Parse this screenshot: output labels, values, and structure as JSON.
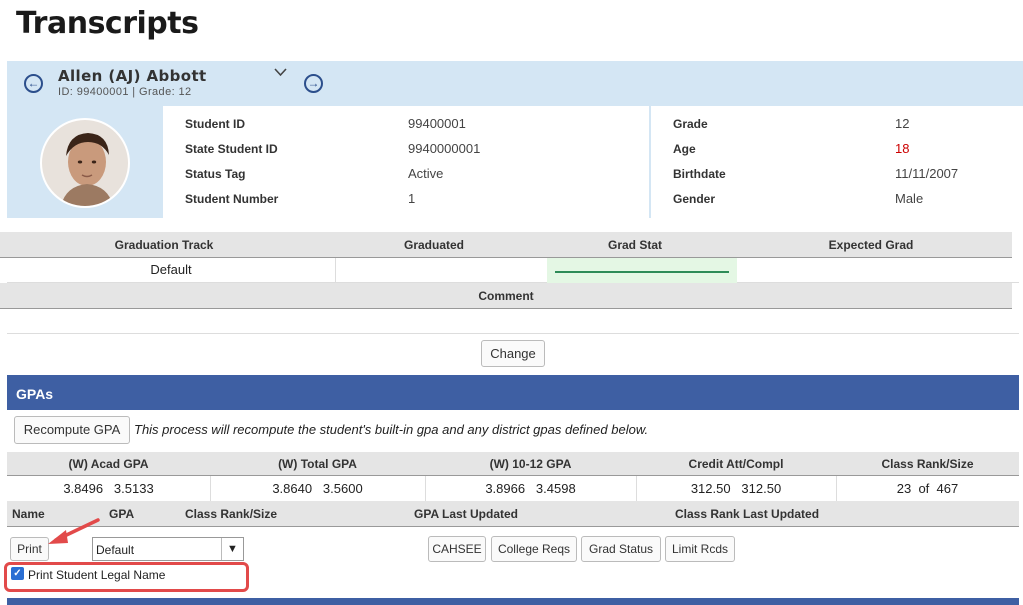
{
  "page": {
    "title": "Transcripts"
  },
  "student": {
    "name": "Allen (AJ) Abbott",
    "sub": "ID: 99400001 |  Grade: 12",
    "fields_left": [
      {
        "label": "Student ID",
        "value": "99400001"
      },
      {
        "label": "State Student ID",
        "value": "9940000001"
      },
      {
        "label": "Status Tag",
        "value": "Active"
      },
      {
        "label": "Student Number",
        "value": "1"
      }
    ],
    "fields_right": [
      {
        "label": "Grade",
        "value": "12"
      },
      {
        "label": "Age",
        "value": "18"
      },
      {
        "label": "Birthdate",
        "value": "11/11/2007"
      },
      {
        "label": "Gender",
        "value": "Male"
      }
    ],
    "age_color": "#cc0000"
  },
  "track": {
    "headers": [
      "Graduation Track",
      "Graduated",
      "Grad Stat",
      "Expected Grad"
    ],
    "values": [
      "Default",
      "",
      "",
      ""
    ],
    "comment_header": "Comment",
    "comment_value": "",
    "change_label": "Change"
  },
  "gpas": {
    "section_title": "GPAs",
    "recompute_label": "Recompute GPA",
    "recompute_note": "This process will recompute the student's built-in gpa and any district gpas defined below.",
    "headers": [
      "(W) Acad GPA",
      "(W) Total GPA",
      "(W) 10-12 GPA",
      "Credit Att/Compl",
      "Class Rank/Size"
    ],
    "values": [
      "3.8496   3.5133",
      "3.8640   3.5600",
      "3.8966   3.4598",
      "312.50   312.50",
      "23  of  467"
    ],
    "list_headers": [
      "Name",
      "GPA",
      "Class Rank/Size",
      "GPA Last Updated",
      "Class Rank Last Updated"
    ],
    "print_label": "Print",
    "gpa_select": "Default",
    "buttons": [
      "CAHSEE",
      "College Reqs",
      "Grad Status",
      "Limit Rcds"
    ],
    "legal_name_label": "Print Student Legal Name",
    "legal_name_checked": true
  },
  "colors": {
    "accent": "#3e5fa3",
    "header_bg": "#d4e6f4",
    "annotation": "#e24a4a"
  }
}
